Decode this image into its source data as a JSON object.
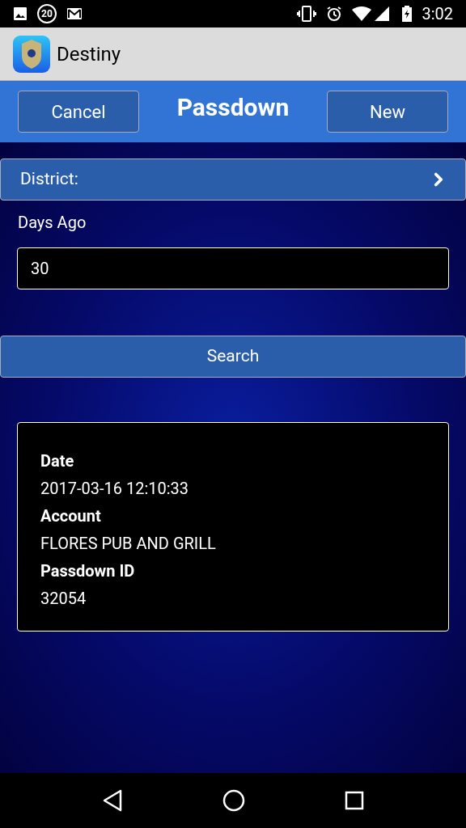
{
  "status_bar": {
    "notification_count": "20",
    "time": "3:02"
  },
  "app_bar": {
    "title": "Destiny"
  },
  "toolbar": {
    "left_button": "Cancel",
    "title": "Passdown",
    "right_button": "New"
  },
  "district": {
    "label": "District:"
  },
  "days_ago": {
    "label": "Days Ago",
    "value": "30"
  },
  "search_button": "Search",
  "result": {
    "fields": [
      {
        "label": "Date",
        "value": "2017-03-16 12:10:33"
      },
      {
        "label": "Account",
        "value": "FLORES PUB AND GRILL"
      },
      {
        "label": "Passdown ID",
        "value": "32054"
      }
    ]
  }
}
